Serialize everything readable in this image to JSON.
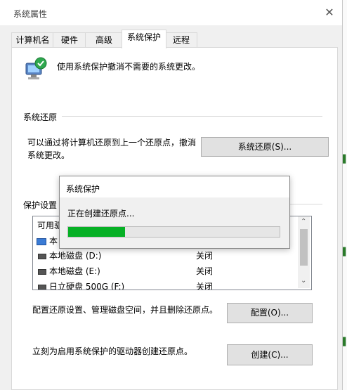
{
  "window": {
    "title": "系统属性"
  },
  "tabs": [
    {
      "label": "计算机名"
    },
    {
      "label": "硬件"
    },
    {
      "label": "高级"
    },
    {
      "label": "系统保护",
      "active": true
    },
    {
      "label": "远程"
    }
  ],
  "intro": {
    "text": "使用系统保护撤消不需要的系统更改。"
  },
  "restore": {
    "group_label": "系统还原",
    "desc_line1": "可以通过将计算机还原到上一个还原点，撤消",
    "desc_line2": "系统更改。",
    "button": "系统还原(S)..."
  },
  "protection": {
    "group_label": "保护设置",
    "list_header_partial": "可用驱",
    "first_row_partial": "本",
    "drives": [
      {
        "name": "本地磁盘 (D:)",
        "status": "关闭"
      },
      {
        "name": "本地磁盘 (E:)",
        "status": "关闭"
      },
      {
        "name": "日立硬盘 500G (F:)",
        "status": "关闭"
      }
    ]
  },
  "configure": {
    "desc": "配置还原设置、管理磁盘空间，并且删除还原点。",
    "button": "配置(O)..."
  },
  "create": {
    "desc": "立刻为启用系统保护的驱动器创建还原点。",
    "button": "创建(C)..."
  },
  "dialog": {
    "title": "系统保护",
    "message": "正在创建还原点...",
    "progress": 0.27
  },
  "colors": {
    "progress_fill": "#06b025",
    "accent": "#0078d7"
  },
  "icons": {
    "close": "close-icon",
    "shield": "system-protection-icon",
    "scroll_up": "chevron-up-icon",
    "scroll_down": "chevron-down-icon"
  }
}
